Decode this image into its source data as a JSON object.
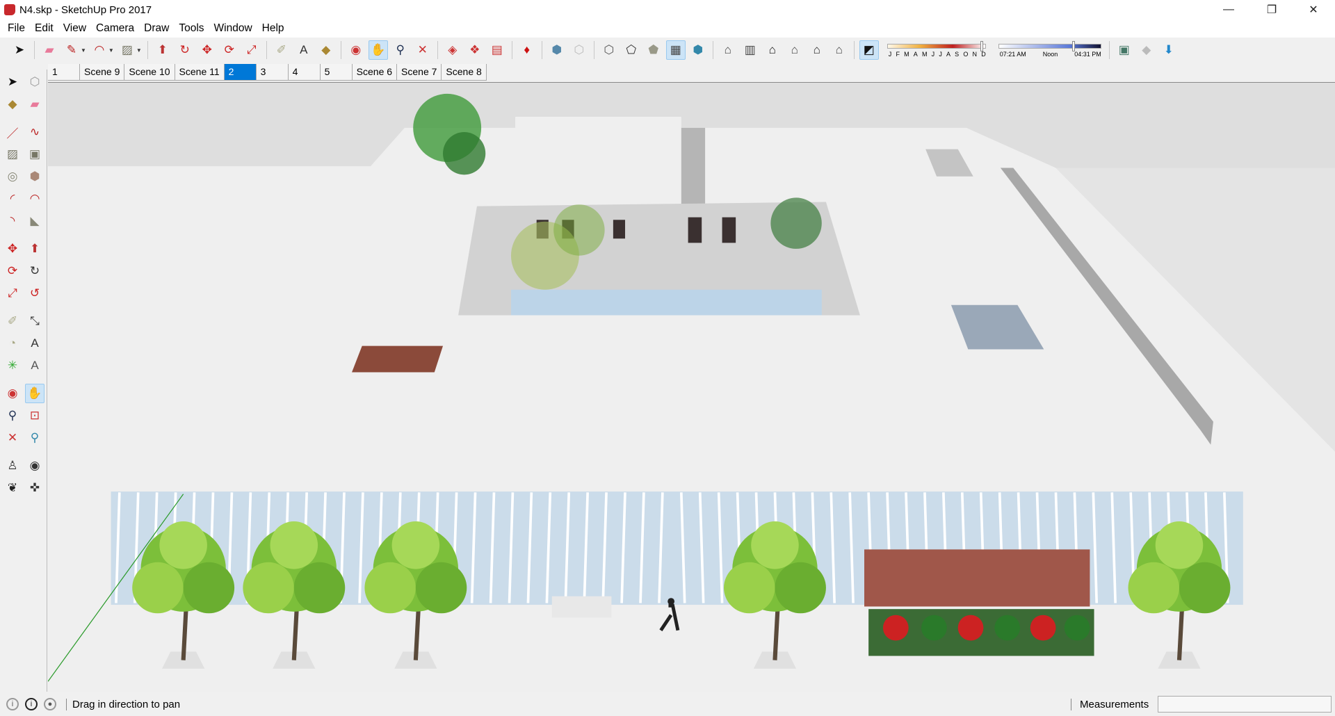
{
  "window": {
    "title": "N4.skp - SketchUp Pro 2017",
    "minimize": "—",
    "maximize": "❐",
    "close": "✕"
  },
  "menu": [
    "File",
    "Edit",
    "View",
    "Camera",
    "Draw",
    "Tools",
    "Window",
    "Help"
  ],
  "toolbar": {
    "icons": [
      {
        "name": "select",
        "glyph": "➤",
        "color": "#111"
      },
      "sep",
      {
        "name": "eraser",
        "glyph": "▰",
        "color": "#e87a9a"
      },
      {
        "name": "pencil",
        "glyph": "✎",
        "color": "#b22",
        "drop": true
      },
      {
        "name": "arc",
        "glyph": "◠",
        "color": "#b22",
        "drop": true
      },
      {
        "name": "rectangle",
        "glyph": "▨",
        "color": "#776",
        "drop": true
      },
      "sep",
      {
        "name": "push-pull",
        "glyph": "⬆",
        "color": "#b33"
      },
      {
        "name": "follow-me",
        "glyph": "↻",
        "color": "#c22"
      },
      {
        "name": "move",
        "glyph": "✥",
        "color": "#c22"
      },
      {
        "name": "rotate",
        "glyph": "⟳",
        "color": "#c22"
      },
      {
        "name": "scale",
        "glyph": "⤢",
        "color": "#c22"
      },
      "sep",
      {
        "name": "tape-measure",
        "glyph": "✐",
        "color": "#aa8"
      },
      {
        "name": "text",
        "glyph": "A",
        "color": "#333"
      },
      {
        "name": "paint-bucket",
        "glyph": "◆",
        "color": "#a83"
      },
      "sep",
      {
        "name": "orbit",
        "glyph": "◉",
        "color": "#c33"
      },
      {
        "name": "pan",
        "glyph": "✋",
        "color": "#cb9",
        "active": true
      },
      {
        "name": "zoom",
        "glyph": "⚲",
        "color": "#235"
      },
      {
        "name": "zoom-extents",
        "glyph": "✕",
        "color": "#c33"
      },
      "sep",
      {
        "name": "warehouse",
        "glyph": "◈",
        "color": "#c33"
      },
      {
        "name": "extension-warehouse",
        "glyph": "❖",
        "color": "#c33"
      },
      {
        "name": "layout",
        "glyph": "▤",
        "color": "#c33"
      },
      "sep",
      {
        "name": "ruby",
        "glyph": "♦",
        "color": "#c11"
      },
      "sep",
      {
        "name": "iso-view",
        "glyph": "⬢",
        "color": "#58a"
      },
      {
        "name": "xray",
        "glyph": "⬡",
        "color": "#bbb"
      },
      "sep",
      {
        "name": "wireframe",
        "glyph": "⬡",
        "color": "#555"
      },
      {
        "name": "hidden-line",
        "glyph": "⬠",
        "color": "#333"
      },
      {
        "name": "shaded",
        "glyph": "⬟",
        "color": "#998"
      },
      {
        "name": "shaded-textures",
        "glyph": "▦",
        "color": "#444",
        "active": true
      },
      {
        "name": "monochrome",
        "glyph": "⬢",
        "color": "#38a"
      },
      "sep",
      {
        "name": "view-iso",
        "glyph": "⌂",
        "color": "#444"
      },
      {
        "name": "view-top",
        "glyph": "▥",
        "color": "#444"
      },
      {
        "name": "view-front",
        "glyph": "⌂",
        "color": "#111"
      },
      {
        "name": "view-right",
        "glyph": "⌂",
        "color": "#444"
      },
      {
        "name": "view-back",
        "glyph": "⌂",
        "color": "#222"
      },
      {
        "name": "view-left",
        "glyph": "⌂",
        "color": "#444"
      },
      "sep",
      {
        "name": "shadows",
        "glyph": "◩",
        "color": "#111",
        "active": true
      }
    ],
    "shadow": {
      "months": [
        "J",
        "F",
        "M",
        "A",
        "M",
        "J",
        "J",
        "A",
        "S",
        "O",
        "N",
        "D"
      ],
      "month_value": 0.97,
      "time_start": "07:21 AM",
      "time_mid": "Noon",
      "time_end": "04:31 PM",
      "time_value": 0.74
    },
    "extra_icons": [
      {
        "name": "add-location",
        "glyph": "▣",
        "color": "#476"
      },
      {
        "name": "toggle-terrain",
        "glyph": "◆",
        "color": "#bbb"
      },
      {
        "name": "photo-textures",
        "glyph": "⬇",
        "color": "#28c"
      }
    ]
  },
  "scenes": [
    {
      "label": "1"
    },
    {
      "label": "Scene 9"
    },
    {
      "label": "Scene 10"
    },
    {
      "label": "Scene 11"
    },
    {
      "label": "2",
      "selected": true
    },
    {
      "label": "3"
    },
    {
      "label": "4"
    },
    {
      "label": "5"
    },
    {
      "label": "Scene 6"
    },
    {
      "label": "Scene 7"
    },
    {
      "label": "Scene 8"
    }
  ],
  "left_toolbar": [
    [
      {
        "name": "select",
        "glyph": "➤",
        "color": "#111"
      },
      {
        "name": "make-component",
        "glyph": "⬡",
        "color": "#999"
      }
    ],
    [
      {
        "name": "paint-bucket",
        "glyph": "◆",
        "color": "#a83"
      },
      {
        "name": "eraser",
        "glyph": "▰",
        "color": "#e87a9a"
      }
    ],
    [
      {
        "name": "line",
        "glyph": "／",
        "color": "#b22"
      },
      {
        "name": "freehand",
        "glyph": "∿",
        "color": "#b22"
      }
    ],
    [
      {
        "name": "rectangle",
        "glyph": "▨",
        "color": "#776"
      },
      {
        "name": "rotated-rectangle",
        "glyph": "▣",
        "color": "#776"
      }
    ],
    [
      {
        "name": "circle",
        "glyph": "◎",
        "color": "#887"
      },
      {
        "name": "polygon",
        "glyph": "⬢",
        "color": "#a87"
      }
    ],
    [
      {
        "name": "arc",
        "glyph": "◜",
        "color": "#b22"
      },
      {
        "name": "two-point-arc",
        "glyph": "◠",
        "color": "#b22"
      }
    ],
    [
      {
        "name": "three-point-arc",
        "glyph": "◝",
        "color": "#b22"
      },
      {
        "name": "pie",
        "glyph": "◣",
        "color": "#887"
      }
    ],
    [
      {
        "name": "move",
        "glyph": "✥",
        "color": "#c22"
      },
      {
        "name": "push-pull",
        "glyph": "⬆",
        "color": "#b33"
      }
    ],
    [
      {
        "name": "rotate",
        "glyph": "⟳",
        "color": "#c22"
      },
      {
        "name": "follow-me",
        "glyph": "↻",
        "color": "#333"
      }
    ],
    [
      {
        "name": "scale",
        "glyph": "⤢",
        "color": "#c22"
      },
      {
        "name": "offset",
        "glyph": "↺",
        "color": "#c22"
      }
    ],
    [
      {
        "name": "tape-measure",
        "glyph": "✐",
        "color": "#aa8"
      },
      {
        "name": "dimension",
        "glyph": "⤡",
        "color": "#333"
      }
    ],
    [
      {
        "name": "protractor",
        "glyph": "◔",
        "color": "#aa8"
      },
      {
        "name": "text",
        "glyph": "A",
        "color": "#333"
      }
    ],
    [
      {
        "name": "axes",
        "glyph": "✳",
        "color": "#3a3"
      },
      {
        "name": "3d-text",
        "glyph": "A",
        "color": "#555"
      }
    ],
    [
      {
        "name": "orbit",
        "glyph": "◉",
        "color": "#c33"
      },
      {
        "name": "pan",
        "glyph": "✋",
        "color": "#cb9",
        "active": true
      }
    ],
    [
      {
        "name": "zoom",
        "glyph": "⚲",
        "color": "#235"
      },
      {
        "name": "zoom-window",
        "glyph": "⊡",
        "color": "#c33"
      }
    ],
    [
      {
        "name": "zoom-extents",
        "glyph": "✕",
        "color": "#c33"
      },
      {
        "name": "previous-view",
        "glyph": "⚲",
        "color": "#38a"
      }
    ],
    [
      {
        "name": "position-camera",
        "glyph": "♙",
        "color": "#333"
      },
      {
        "name": "look-around",
        "glyph": "◉",
        "color": "#333"
      }
    ],
    [
      {
        "name": "walk",
        "glyph": "❦",
        "color": "#222"
      },
      {
        "name": "section-plane",
        "glyph": "✜",
        "color": "#333"
      }
    ]
  ],
  "status": {
    "text": "Drag in direction to pan",
    "measurements_label": "Measurements",
    "measurements_value": ""
  }
}
